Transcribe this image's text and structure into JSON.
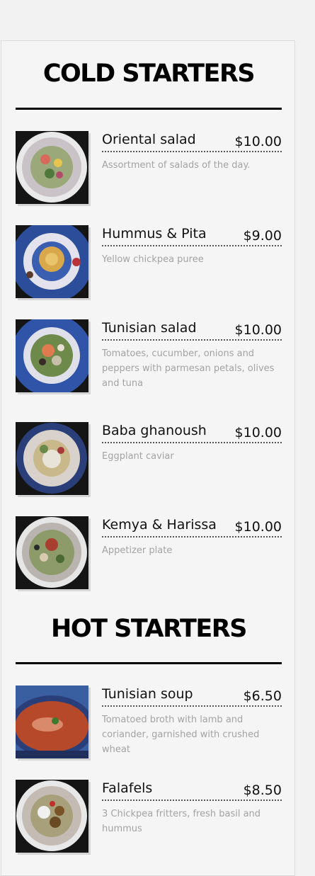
{
  "sections": [
    {
      "title": "COLD STARTERS",
      "items": [
        {
          "name": "Oriental salad",
          "price": "$10.00",
          "description": "Assortment of salads of the day."
        },
        {
          "name": "Hummus & Pita",
          "price": "$9.00",
          "description": "Yellow chickpea puree"
        },
        {
          "name": "Tunisian salad",
          "price": "$10.00",
          "description": "Tomatoes, cucumber, onions and peppers with parmesan petals, olives and tuna"
        },
        {
          "name": "Baba ghanoush",
          "price": "$10.00",
          "description": "Eggplant caviar"
        },
        {
          "name": "Kemya & Harissa",
          "price": "$10.00",
          "description": "Appetizer plate"
        }
      ]
    },
    {
      "title": "HOT STARTERS",
      "items": [
        {
          "name": "Tunisian soup",
          "price": "$6.50",
          "description": "Tomatoed broth with lamb and coriander, garnished with crushed wheat"
        },
        {
          "name": "Falafels",
          "price": "$8.50",
          "description": "3 Chickpea fritters, fresh basil and hummus"
        }
      ]
    }
  ]
}
